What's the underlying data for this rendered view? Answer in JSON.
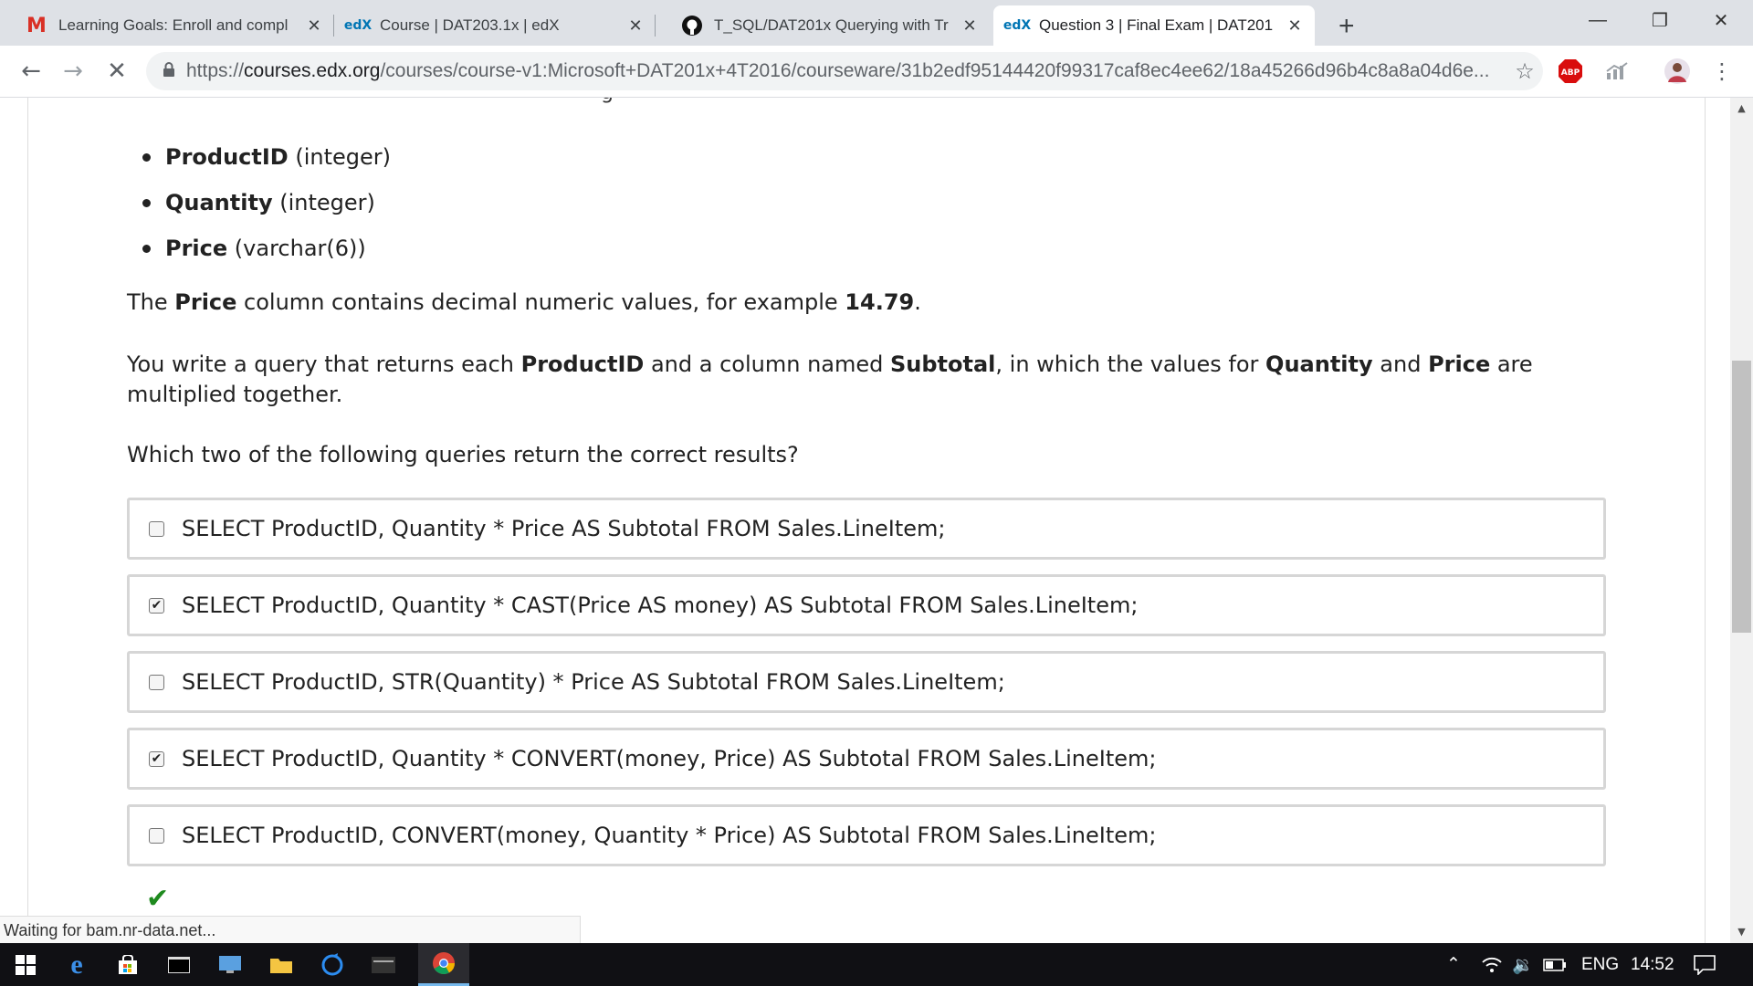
{
  "browser": {
    "tabs": [
      {
        "favicon": "gmail-icon",
        "fav_text": "M",
        "fav_color": "#d93025",
        "title": "Learning Goals: Enroll and compl",
        "active": false
      },
      {
        "favicon": "edx-icon",
        "fav_text": "edX",
        "fav_color": "#0075b4",
        "title": "Course | DAT203.1x | edX",
        "active": false
      },
      {
        "favicon": "github-icon",
        "fav_text": "",
        "fav_color": "#000000",
        "title": "T_SQL/DAT201x Querying with Tr",
        "active": false
      },
      {
        "favicon": "edx-icon",
        "fav_text": "edX",
        "fav_color": "#0075b4",
        "title": "Question 3 | Final Exam | DAT201",
        "active": true
      }
    ],
    "url_prefix": "https://",
    "url_host": "courses.edx.org",
    "url_path": "/courses/course-v1:Microsoft+DAT201x+4T2016/courseware/31b2edf95144420f99317caf8ec4ee62/18a45266d96b4c8a8a04d6e...",
    "abp_label": "ABP"
  },
  "content": {
    "fields": [
      {
        "name": "ProductID",
        "type": "(integer)"
      },
      {
        "name": "Quantity",
        "type": "(integer)"
      },
      {
        "name": "Price",
        "type": "(varchar(6))"
      }
    ],
    "p1": {
      "a": "The ",
      "b": "Price",
      "c": " column contains decimal numeric values, for example ",
      "d": "14.79",
      "e": "."
    },
    "p2": {
      "a": "You write a query that returns each ",
      "b": "ProductID",
      "c": " and a column named ",
      "d": "Subtotal",
      "e": ", in which the values for ",
      "f": "Quantity",
      "g": " and ",
      "h": "Price",
      "i": " are multiplied together."
    },
    "p3": "Which two of the following queries return the correct results?",
    "choices": [
      {
        "text": "SELECT ProductID, Quantity * Price AS Subtotal FROM Sales.LineItem;",
        "checked": false
      },
      {
        "text": "SELECT ProductID, Quantity * CAST(Price AS money) AS Subtotal FROM Sales.LineItem;",
        "checked": true
      },
      {
        "text": "SELECT ProductID, STR(Quantity) * Price AS Subtotal FROM Sales.LineItem;",
        "checked": false
      },
      {
        "text": "SELECT ProductID, Quantity * CONVERT(money, Price) AS Subtotal FROM Sales.LineItem;",
        "checked": true
      },
      {
        "text": "SELECT ProductID, CONVERT(money, Quantity * Price) AS Subtotal FROM Sales.LineItem;",
        "checked": false
      }
    ],
    "status_text": "Waiting for bam.nr-data.net..."
  },
  "taskbar": {
    "language": "ENG",
    "time": "14:52"
  }
}
